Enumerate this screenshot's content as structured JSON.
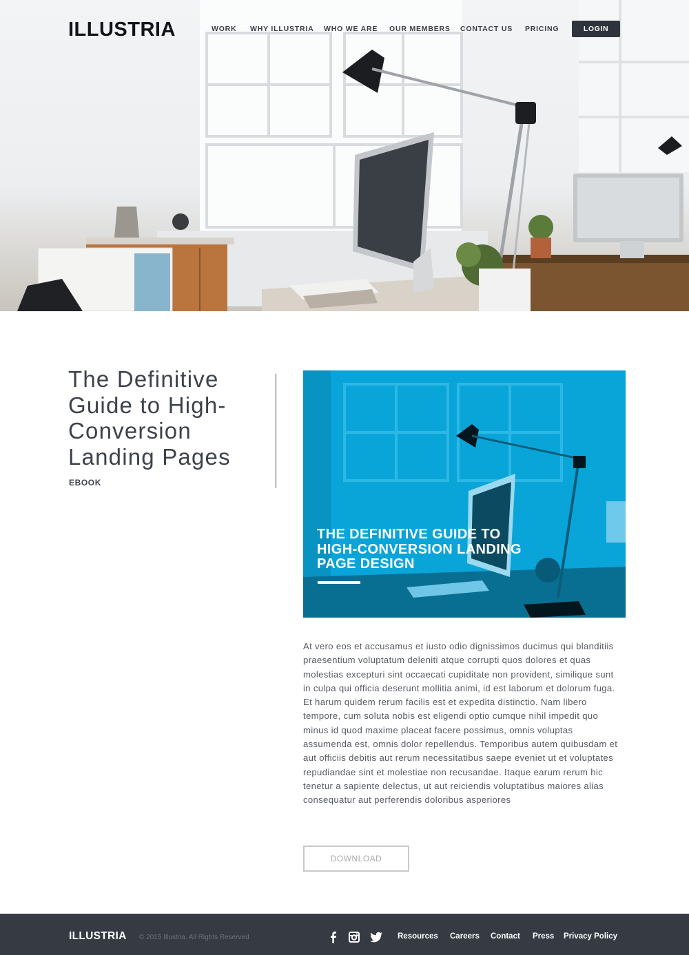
{
  "header": {
    "logo": "ILLUSTRIA",
    "nav": [
      "WORK",
      "WHY ILLUSTRIA",
      "WHO WE ARE",
      "OUR MEMBERS",
      "CONTACT US",
      "PRICING"
    ],
    "login_label": "LOGIN"
  },
  "article": {
    "title": "The Definitive Guide to High-Conversion Landing Pages",
    "tag": "EBOOK",
    "cover_title": "THE DEFINITIVE GUIDE TO HIGH-CONVERSION LANDING PAGE DESIGN",
    "body": "At vero eos et accusamus et iusto odio dignissimos ducimus qui blanditiis praesentium voluptatum deleniti atque corrupti quos dolores et quas molestias excepturi sint occaecati cupiditate non provident, similique sunt in culpa qui officia deserunt mollitia animi, id est laborum et dolorum fuga. Et harum quidem rerum facilis est et expedita distinctio. Nam libero tempore, cum soluta nobis est eligendi optio cumque nihil impedit quo minus id quod maxime placeat facere possimus, omnis voluptas assumenda est, omnis dolor repellendus. Temporibus autem quibusdam et aut officiis debitis aut rerum necessitatibus saepe eveniet ut et voluptates repudiandae sint et molestiae non recusandae. Itaque earum rerum hic tenetur a sapiente delectus, ut aut reiciendis voluptatibus maiores alias consequatur aut perferendis doloribus asperiores",
    "download_label": "DOWNLOAD"
  },
  "footer": {
    "logo": "ILLUSTRIA",
    "copyright": "© 2015 Illustria. All Rights Reserved",
    "social": [
      "facebook-icon",
      "instagram-icon",
      "twitter-icon"
    ],
    "links": [
      "Resources",
      "Careers",
      "Contact",
      "Press",
      "Privacy Policy"
    ]
  },
  "colors": {
    "dark": "#2f333b",
    "footer_bg": "#353a43",
    "cover_blue": "#0aa5d8",
    "text": "#3d424b",
    "body_text": "#555a62"
  }
}
